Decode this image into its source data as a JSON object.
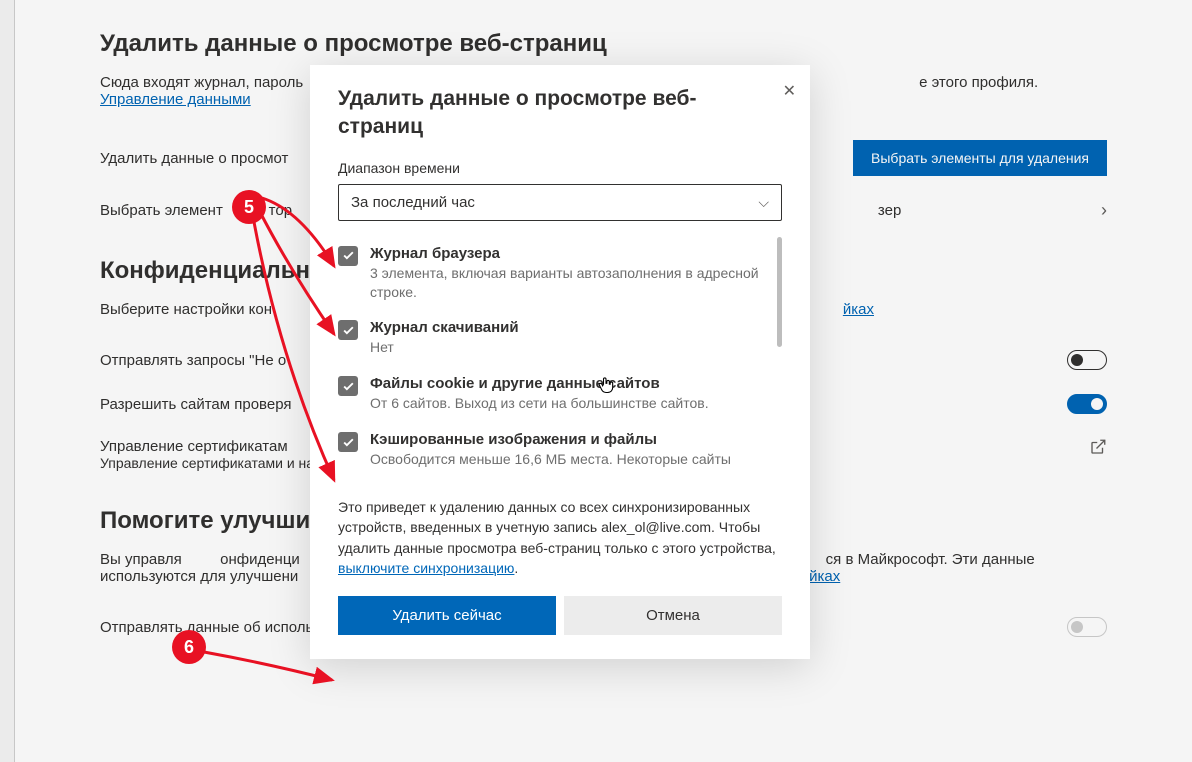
{
  "page": {
    "section1_title": "Удалить данные о просмотре веб-страниц",
    "section1_desc_a": "Сюда входят журнал, пароль",
    "section1_desc_b": "е этого профиля. ",
    "section1_link": "Управление данными",
    "row_clear_label": "Удалить данные о просмот",
    "row_clear_button": "Выбрать элементы для удаления",
    "row_choose_label": "Выбрать элемент",
    "row_choose_tail": "тор",
    "row_choose_tail2": "зер",
    "section2_title": "Конфиденциально",
    "section2_desc_a": "Выберите настройки кон",
    "section2_link": "йках",
    "row_dnt": "Отправлять запросы \"Не о",
    "row_sites": "Разрешить сайтам проверя",
    "row_cert_title": "Управление сертификатам",
    "row_cert_sub": "Управление сертификатами и на",
    "section3_title": "Помогите улучшит",
    "section3_desc_a": "Вы управля",
    "section3_desc_b": "онфиденци",
    "section3_desc_c": "ся в Майкрософт. Эти данные используются для улучшени",
    "section3_link": "йках",
    "row_telemetry": "Отправлять данные об использовании браузера для улучшения продуктов Майкрософт"
  },
  "modal": {
    "title": "Удалить данные о просмотре веб-страниц",
    "range_label": "Диапазон времени",
    "range_value": "За последний час",
    "options": [
      {
        "title": "Журнал браузера",
        "sub": "3 элемента, включая варианты автозаполнения в адресной строке."
      },
      {
        "title": "Журнал скачиваний",
        "sub": "Нет"
      },
      {
        "title": "Файлы cookie и другие данные сайтов",
        "sub": "От 6 сайтов. Выход из сети на большинстве сайтов."
      },
      {
        "title": "Кэшированные изображения и файлы",
        "sub": "Освободится меньше 16,6 МБ места. Некоторые сайты"
      }
    ],
    "note_a": "Это приведет к удалению данных со всех синхронизированных устройств, введенных в учетную запись alex_ol@live.com. Чтобы удалить данные просмотра веб-страниц только с этого устройства, ",
    "note_link": "выключите синхронизацию",
    "btn_clear": "Удалить сейчас",
    "btn_cancel": "Отмена"
  },
  "annotations": {
    "badge5": "5",
    "badge6": "6"
  }
}
